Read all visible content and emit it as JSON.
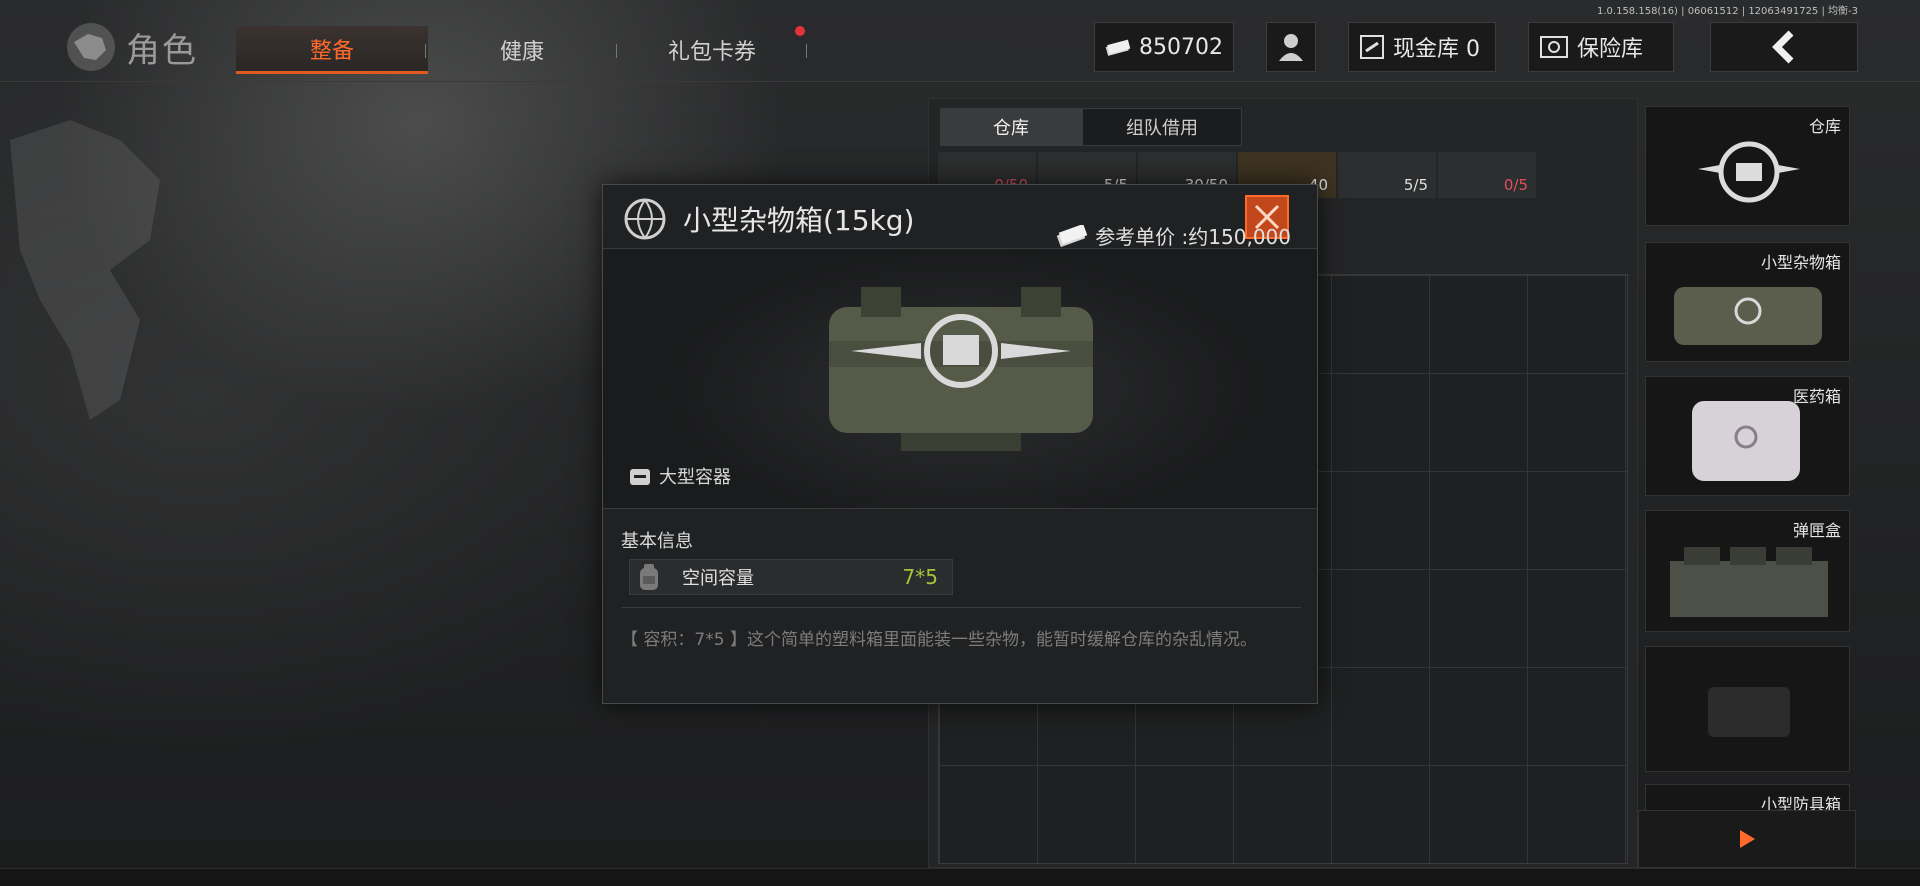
{
  "version": "1.0.158.158(16) | 06061512 | 12063491725 | 均衡-3",
  "header": {
    "title": "角色",
    "tabs": [
      {
        "label": "整备",
        "active": true
      },
      {
        "label": "健康",
        "active": false
      },
      {
        "label": "礼包卡券",
        "active": false
      }
    ],
    "currency": "850702",
    "cash_vault": "现金库 0",
    "safe": "保险库"
  },
  "warehouse": {
    "tabs": [
      "仓库",
      "组队借用"
    ],
    "strip": [
      "0/50",
      "5/5",
      "30/50",
      "40",
      "5/5",
      "0/5"
    ]
  },
  "sidebar": {
    "items": [
      {
        "label": "仓库"
      },
      {
        "label": "小型杂物箱"
      },
      {
        "label": "医药箱"
      },
      {
        "label": "弹匣盒"
      },
      {
        "label": ""
      },
      {
        "label": "小型防具箱"
      }
    ]
  },
  "dialog": {
    "title": "小型杂物箱(15kg)",
    "price_label": "参考单价 :约150,000",
    "container_type": "大型容器",
    "section_title": "基本信息",
    "attr_label": "空间容量",
    "attr_value": "7*5",
    "description": "【 容积：7*5 】这个简单的塑料箱里面能装一些杂物，能暂时缓解仓库的杂乱情况。"
  },
  "colors": {
    "accent": "#e15a22",
    "value_green": "#a7c33a"
  }
}
